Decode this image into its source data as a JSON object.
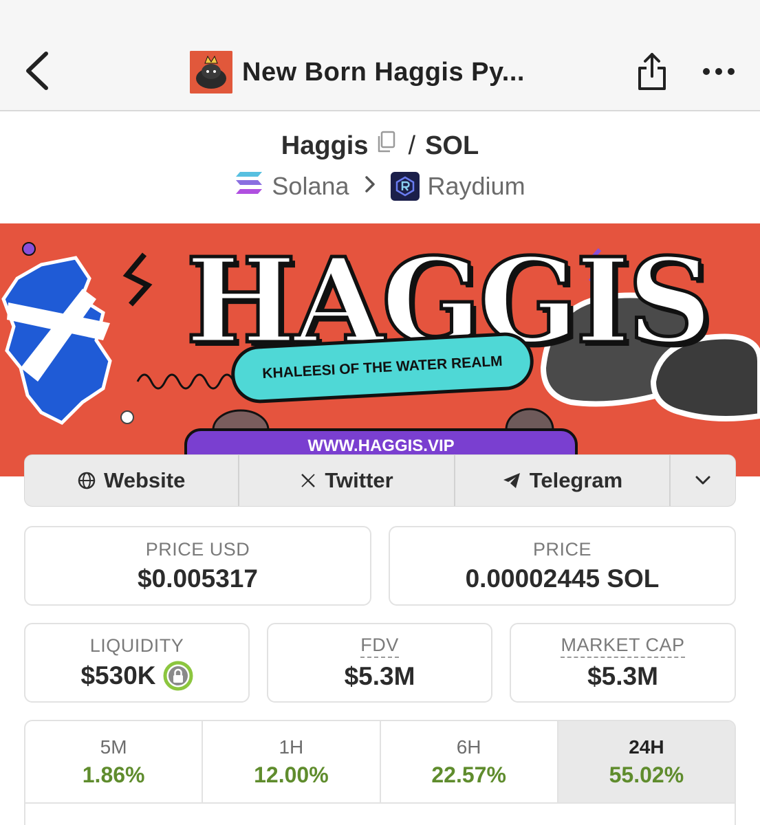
{
  "header": {
    "title": "New Born Haggis Py..."
  },
  "pair": {
    "base": "Haggis",
    "separator": "/",
    "quote": "SOL",
    "chain": "Solana",
    "dex": "Raydium"
  },
  "banner": {
    "title": "HAGGIS",
    "tagline": "KHALEESI OF THE WATER REALM",
    "url": "WWW.HAGGIS.VIP"
  },
  "links": {
    "website": "Website",
    "twitter": "Twitter",
    "telegram": "Telegram"
  },
  "stats": {
    "price_usd": {
      "label": "PRICE USD",
      "value": "$0.005317"
    },
    "price_native": {
      "label": "PRICE",
      "value": "0.00002445 SOL"
    },
    "liquidity": {
      "label": "LIQUIDITY",
      "value": "$530K"
    },
    "fdv": {
      "label": "FDV",
      "value": "$5.3M"
    },
    "market_cap": {
      "label": "MARKET CAP",
      "value": "$5.3M"
    }
  },
  "changes": [
    {
      "period": "5M",
      "pct": "1.86%"
    },
    {
      "period": "1H",
      "pct": "12.00%"
    },
    {
      "period": "6H",
      "pct": "22.57%"
    },
    {
      "period": "24H",
      "pct": "55.02%"
    }
  ],
  "colors": {
    "positive": "#5f8c2d",
    "banner_bg": "#e5543e",
    "tagline_bg": "#4fd8d6",
    "url_bg": "#7a3fd0"
  }
}
